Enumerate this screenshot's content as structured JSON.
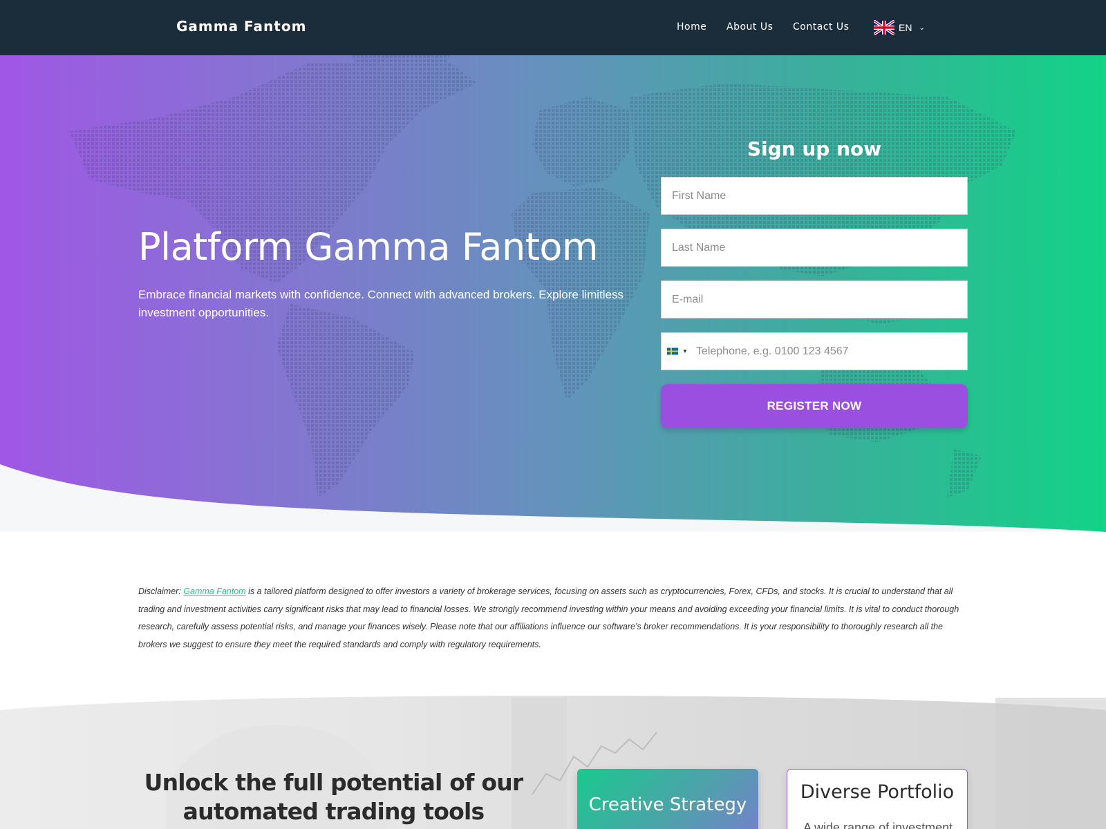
{
  "nav": {
    "brand": "Gamma Fantom",
    "links": [
      "Home",
      "About Us",
      "Contact Us"
    ],
    "language": "EN"
  },
  "hero": {
    "title": "Platform Gamma Fantom",
    "subtitle": "Embrace financial markets with confidence. Connect with advanced brokers. Explore limitless investment opportunities."
  },
  "signup": {
    "title": "Sign up now",
    "first_name_placeholder": "First Name",
    "last_name_placeholder": "Last Name",
    "email_placeholder": "E-mail",
    "phone_placeholder": "Telephone, e.g.  0100 123 4567",
    "register_label": "REGISTER NOW"
  },
  "disclaimer": {
    "prefix": "Disclaimer: ",
    "link": "Gamma Fantom",
    "text": " is a tailored platform designed to offer investors a variety of brokerage services, focusing on assets such as cryptocurrencies, Forex, CFDs, and stocks. It is crucial to understand that all trading and investment activities carry significant risks that may lead to financial losses. We strongly recommend investing within your means and avoiding exceeding your financial limits. It is vital to conduct thorough research, carefully assess potential risks, and manage your finances wisely. Please note that our affiliations influence our software’s broker recommendations. It is your responsibility to thoroughly research all the brokers we suggest to ensure they meet the required standards and comply with regulatory requirements."
  },
  "features": {
    "heading": "Unlock the full potential of our automated trading tools",
    "card1_title": "Creative Strategy",
    "card2_title": "Diverse Portfolio",
    "card2_text": "A wide range of investment"
  },
  "colors": {
    "nav_bg": "#1b2d3a",
    "gradient_start": "#a057e5",
    "gradient_end": "#12d386",
    "button": "#9b4fe0",
    "link": "#19c58f"
  }
}
